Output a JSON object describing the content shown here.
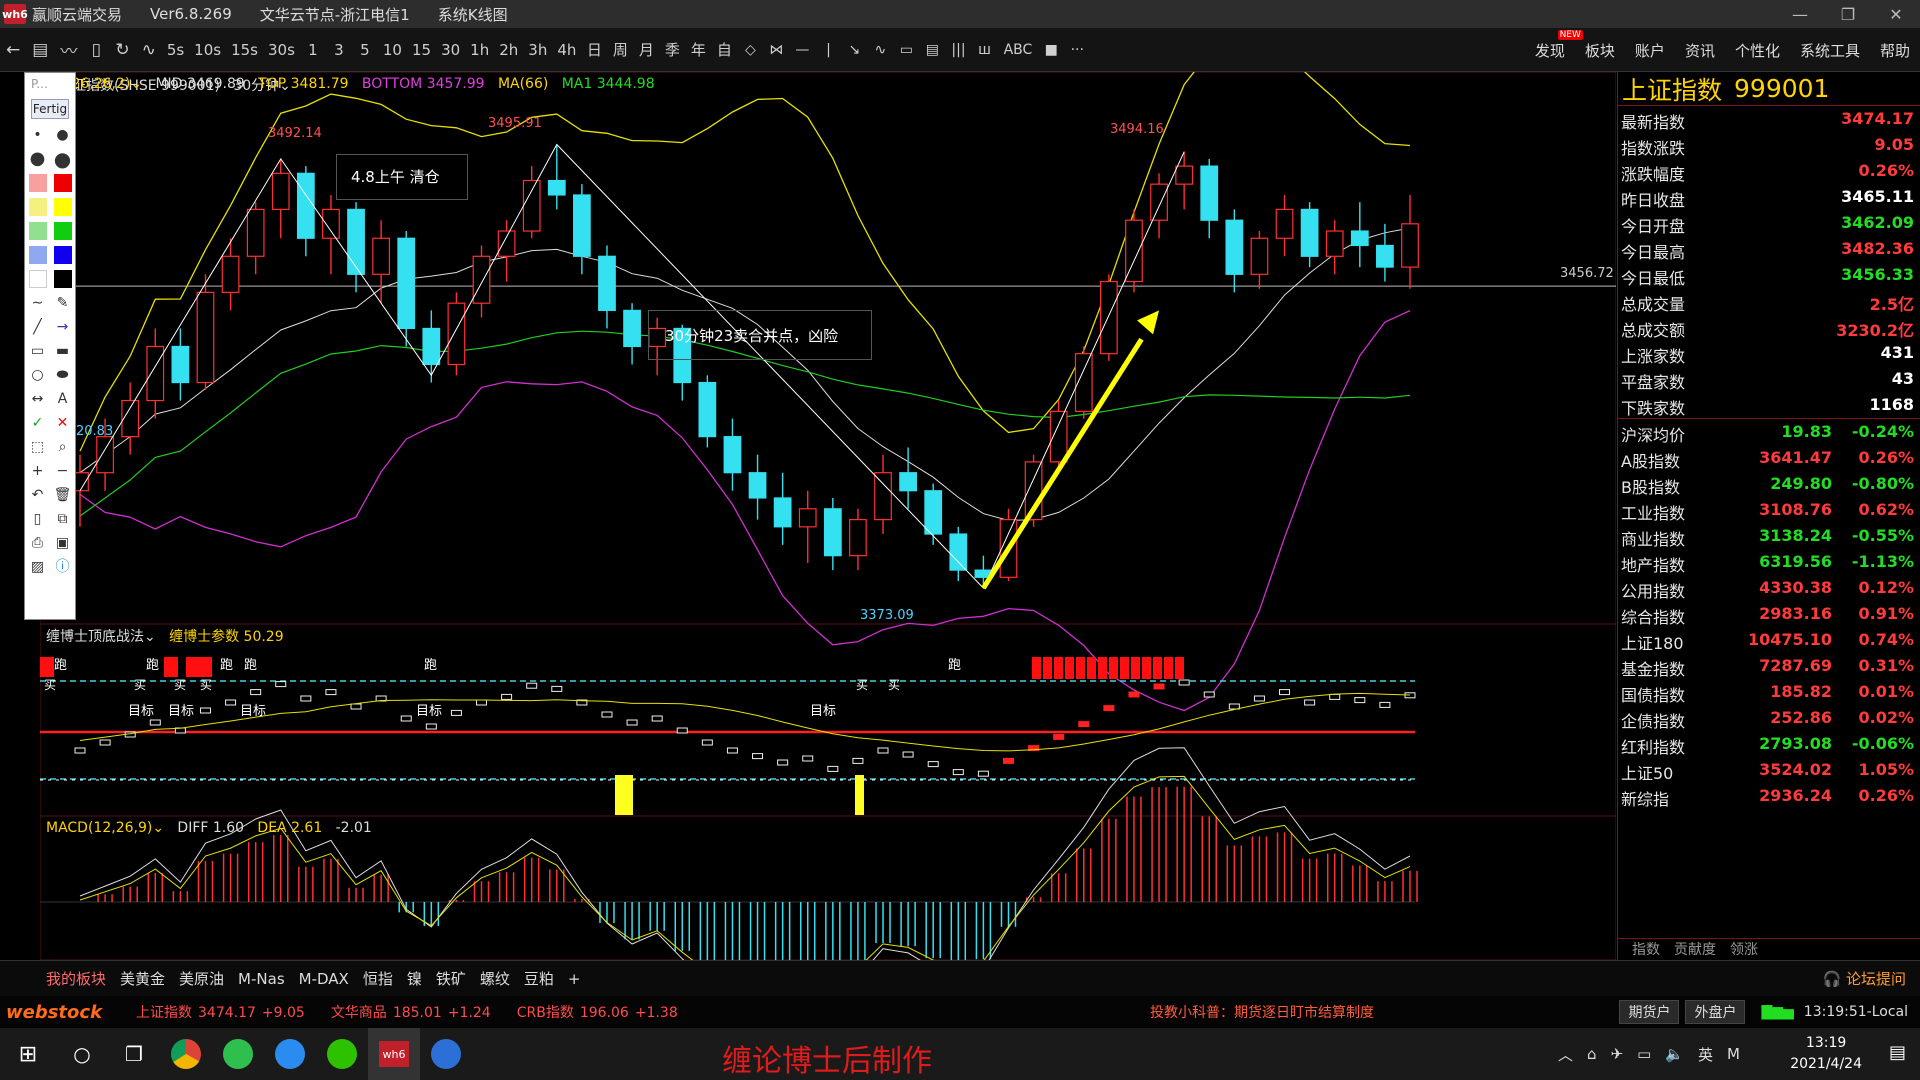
{
  "window": {
    "app_name": "赢顺云端交易",
    "version": "Ver6.8.269",
    "server": "文华云节点-浙江电信1",
    "view": "系统K线图",
    "logo": "wh6"
  },
  "toolbar": {
    "icons": [
      "back-icon",
      "list-icon",
      "line-chart-icon",
      "candle-icon",
      "refresh-icon",
      "tick-chart-icon"
    ],
    "periods": [
      "5s",
      "10s",
      "15s",
      "30s",
      "1",
      "3",
      "5",
      "10",
      "15",
      "30",
      "1h",
      "2h",
      "3h",
      "4h",
      "日",
      "周",
      "月",
      "季",
      "年",
      "自"
    ],
    "tools": [
      "◇",
      "⋈",
      "—",
      "|",
      "↘",
      "∿",
      "▭",
      "▤",
      "|||",
      "ш",
      "ABC",
      "■",
      "···"
    ],
    "menu": [
      "发现",
      "板块",
      "账户",
      "资讯",
      "个性化",
      "系统工具",
      "帮助"
    ],
    "new_badge": "NEW"
  },
  "palette": {
    "header": "P...",
    "done_label": "Fertig"
  },
  "main_chart": {
    "instrument": "上证指数(SHSE 999001)",
    "period": "30分钟",
    "indicator_params": "(26,26,2)",
    "mid": "MID 3469.89",
    "top": "TOP 3481.79",
    "bottom": "BOTTOM 3457.99",
    "ma66": "MA(66)",
    "ma1": "MA1 3444.98",
    "price_labels": {
      "high1": "3492.14",
      "high2": "3495.91",
      "high3": "3494.16",
      "low": "3373.09",
      "left_low": "20.83",
      "ref_line": "3456.72"
    },
    "notes": [
      "4.8上午  清仓",
      "30分钟23卖合并点，凶险"
    ]
  },
  "panel2": {
    "title": "缠博士顶底战法",
    "param": "缠博士参数 50.29",
    "markers": {
      "run": "跑",
      "buy": "买",
      "target": "目标"
    }
  },
  "macd": {
    "title": "MACD(12,26,9)",
    "diff": "DIFF 1.60",
    "dea": "DEA 2.61",
    "macd": "-2.01"
  },
  "quote": {
    "name": "上证指数",
    "code": "999001",
    "rows": [
      {
        "label": "最新指数",
        "value": "3474.17",
        "color": "#ff3b3b"
      },
      {
        "label": "指数涨跌",
        "value": "9.05",
        "color": "#ff3b3b"
      },
      {
        "label": "涨跌幅度",
        "value": "0.26%",
        "color": "#ff3b3b"
      },
      {
        "label": "昨日收盘",
        "value": "3465.11",
        "color": "#ffffff"
      },
      {
        "label": "今日开盘",
        "value": "3462.09",
        "color": "#22dd22"
      },
      {
        "label": "今日最高",
        "value": "3482.36",
        "color": "#ff3b3b"
      },
      {
        "label": "今日最低",
        "value": "3456.33",
        "color": "#22dd22"
      },
      {
        "label": "总成交量",
        "value": "2.5亿",
        "color": "#ff3b3b"
      },
      {
        "label": "总成交额",
        "value": "3230.2亿",
        "color": "#ff3b3b"
      },
      {
        "label": "上涨家数",
        "value": "431",
        "color": "#ffffff"
      },
      {
        "label": "平盘家数",
        "value": "43",
        "color": "#ffffff"
      },
      {
        "label": "下跌家数",
        "value": "1168",
        "color": "#ffffff"
      }
    ],
    "indices": [
      {
        "label": "沪深均价",
        "price": "19.83",
        "pct": "-0.24%",
        "pcolor": "#22dd22",
        "color": "#22dd22"
      },
      {
        "label": "A股指数",
        "price": "3641.47",
        "pct": "0.26%",
        "pcolor": "#ff3b3b",
        "color": "#ff3b3b"
      },
      {
        "label": "B股指数",
        "price": "249.80",
        "pct": "-0.80%",
        "pcolor": "#ff3b3b",
        "color": "#22dd22"
      },
      {
        "label": "工业指数",
        "price": "3108.76",
        "pct": "0.62%",
        "pcolor": "#ff3b3b",
        "color": "#ff3b3b"
      },
      {
        "label": "商业指数",
        "price": "3138.24",
        "pct": "-0.55%",
        "pcolor": "#ff3b3b",
        "color": "#22dd22"
      },
      {
        "label": "地产指数",
        "price": "6319.56",
        "pct": "-1.13%",
        "pcolor": "#ff3b3b",
        "color": "#22dd22"
      },
      {
        "label": "公用指数",
        "price": "4330.38",
        "pct": "0.12%",
        "pcolor": "#ff3b3b",
        "color": "#ff3b3b"
      },
      {
        "label": "综合指数",
        "price": "2983.16",
        "pct": "0.91%",
        "pcolor": "#ff3b3b",
        "color": "#ff3b3b"
      },
      {
        "label": "上证180",
        "price": "10475.10",
        "pct": "0.74%",
        "pcolor": "#ff3b3b",
        "color": "#ff3b3b"
      },
      {
        "label": "基金指数",
        "price": "7287.69",
        "pct": "0.31%",
        "pcolor": "#ff3b3b",
        "color": "#ff3b3b"
      },
      {
        "label": "国债指数",
        "price": "185.82",
        "pct": "0.01%",
        "pcolor": "#ff3b3b",
        "color": "#ff3b3b"
      },
      {
        "label": "企债指数",
        "price": "252.86",
        "pct": "0.02%",
        "pcolor": "#ff3b3b",
        "color": "#ff3b3b"
      },
      {
        "label": "红利指数",
        "price": "2793.08",
        "pct": "-0.06%",
        "pcolor": "#ff3b3b",
        "color": "#22dd22"
      },
      {
        "label": "上证50",
        "price": "3524.02",
        "pct": "1.05%",
        "pcolor": "#ff3b3b",
        "color": "#ff3b3b"
      },
      {
        "label": "新综指",
        "price": "2936.24",
        "pct": "0.26%",
        "pcolor": "#ff3b3b",
        "color": "#ff3b3b"
      }
    ],
    "tabs": [
      "指数",
      "贡献度",
      "领涨"
    ]
  },
  "bottom_tabs": {
    "items": [
      "我的板块",
      "美黄金",
      "美原油",
      "M-Nas",
      "M-DAX",
      "恒指",
      "镍",
      "铁矿",
      "螺纹",
      "豆粕",
      "+"
    ],
    "forum": "论坛提问"
  },
  "status": {
    "brand": "webstock",
    "tickers": [
      {
        "name": "上证指数",
        "price": "3474.17",
        "chg": "+9.05"
      },
      {
        "name": "文华商品",
        "price": "185.01",
        "chg": "+1.24"
      },
      {
        "name": "CRB指数",
        "price": "196.06",
        "chg": "+1.38"
      }
    ],
    "news": "投教小科普：期货逐日盯市结算制度",
    "buttons": [
      "期货户",
      "外盘户"
    ],
    "time_local": "13:19:51-Local"
  },
  "taskbar": {
    "caption": "缠论博士后制作",
    "time": "13:19",
    "date": "2021/4/24",
    "lang": "英",
    "ime": "M"
  },
  "chart_data": {
    "type": "candlestick",
    "period": "30分钟",
    "ohlc": [
      [
        3400,
        3410,
        3390,
        3405
      ],
      [
        3405,
        3420,
        3400,
        3415
      ],
      [
        3415,
        3430,
        3410,
        3425
      ],
      [
        3425,
        3445,
        3420,
        3440
      ],
      [
        3440,
        3445,
        3425,
        3430
      ],
      [
        3430,
        3460,
        3428,
        3455
      ],
      [
        3455,
        3470,
        3450,
        3465
      ],
      [
        3465,
        3480,
        3460,
        3478
      ],
      [
        3478,
        3492,
        3470,
        3488
      ],
      [
        3488,
        3490,
        3465,
        3470
      ],
      [
        3470,
        3482,
        3460,
        3478
      ],
      [
        3478,
        3480,
        3455,
        3460
      ],
      [
        3460,
        3475,
        3452,
        3470
      ],
      [
        3470,
        3472,
        3440,
        3445
      ],
      [
        3445,
        3450,
        3430,
        3435
      ],
      [
        3435,
        3455,
        3432,
        3452
      ],
      [
        3452,
        3468,
        3448,
        3465
      ],
      [
        3465,
        3475,
        3458,
        3472
      ],
      [
        3472,
        3490,
        3470,
        3486
      ],
      [
        3486,
        3496,
        3478,
        3482
      ],
      [
        3482,
        3485,
        3460,
        3465
      ],
      [
        3465,
        3468,
        3445,
        3450
      ],
      [
        3450,
        3452,
        3435,
        3440
      ],
      [
        3440,
        3448,
        3432,
        3445
      ],
      [
        3445,
        3446,
        3425,
        3430
      ],
      [
        3430,
        3432,
        3412,
        3415
      ],
      [
        3415,
        3420,
        3400,
        3405
      ],
      [
        3405,
        3410,
        3392,
        3398
      ],
      [
        3398,
        3405,
        3385,
        3390
      ],
      [
        3390,
        3400,
        3380,
        3395
      ],
      [
        3395,
        3398,
        3378,
        3382
      ],
      [
        3382,
        3395,
        3378,
        3392
      ],
      [
        3392,
        3410,
        3388,
        3405
      ],
      [
        3405,
        3412,
        3395,
        3400
      ],
      [
        3400,
        3402,
        3385,
        3388
      ],
      [
        3388,
        3390,
        3375,
        3378
      ],
      [
        3378,
        3382,
        3373,
        3376
      ],
      [
        3376,
        3395,
        3375,
        3392
      ],
      [
        3392,
        3410,
        3390,
        3408
      ],
      [
        3408,
        3425,
        3405,
        3422
      ],
      [
        3422,
        3440,
        3420,
        3438
      ],
      [
        3438,
        3460,
        3436,
        3458
      ],
      [
        3458,
        3478,
        3455,
        3475
      ],
      [
        3475,
        3488,
        3470,
        3485
      ],
      [
        3485,
        3494,
        3478,
        3490
      ],
      [
        3490,
        3492,
        3470,
        3475
      ],
      [
        3475,
        3478,
        3455,
        3460
      ],
      [
        3460,
        3472,
        3456,
        3470
      ],
      [
        3470,
        3482,
        3465,
        3478
      ],
      [
        3478,
        3480,
        3462,
        3465
      ],
      [
        3465,
        3475,
        3460,
        3472
      ],
      [
        3472,
        3480,
        3462,
        3468
      ],
      [
        3468,
        3474,
        3458,
        3462
      ],
      [
        3462,
        3482,
        3456,
        3474
      ]
    ],
    "annotations": [
      "3492.14",
      "3495.91",
      "3494.16",
      "3373.09"
    ],
    "ref_line": 3456.72
  }
}
